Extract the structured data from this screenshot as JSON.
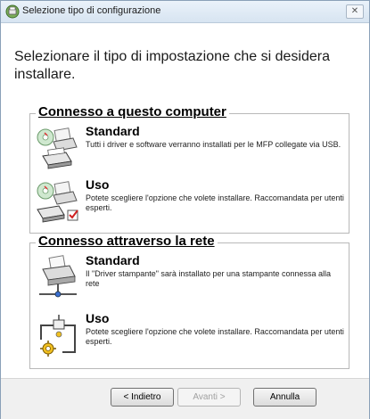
{
  "window": {
    "title": "Selezione tipo di configurazione",
    "close_label": "✕"
  },
  "heading": "Selezionare  il tipo di impostazione che si desidera installare.",
  "groups": [
    {
      "legend": "Connesso a questo computer",
      "options": [
        {
          "title": "Standard",
          "description": "Tutti i driver e software verranno installati per le MFP collegate via USB.",
          "icon": "printer-cd-icon"
        },
        {
          "title": "Uso",
          "description": "Potete scegliere l'opzione che volete installare. Raccomandata per utenti esperti.",
          "icon": "printer-cd-checkbox-icon"
        }
      ]
    },
    {
      "legend": "Connesso attraverso la rete",
      "options": [
        {
          "title": "Standard",
          "description": "Il \"Driver stampante\" sarà installato per una stampante connessa alla rete",
          "icon": "network-printer-icon"
        },
        {
          "title": "Uso",
          "description": "Potete scegliere l'opzione che volete installare. Raccomandata per utenti esperti.",
          "icon": "network-gear-icon"
        }
      ]
    }
  ],
  "buttons": {
    "back": "< Indietro",
    "next": "Avanti >",
    "cancel": "Annulla"
  },
  "colors": {
    "titlebar": "#dfe8f2",
    "content_background": "#ffffff",
    "footer_background": "#f0f0f0",
    "checkbox_red": "#d02020"
  }
}
